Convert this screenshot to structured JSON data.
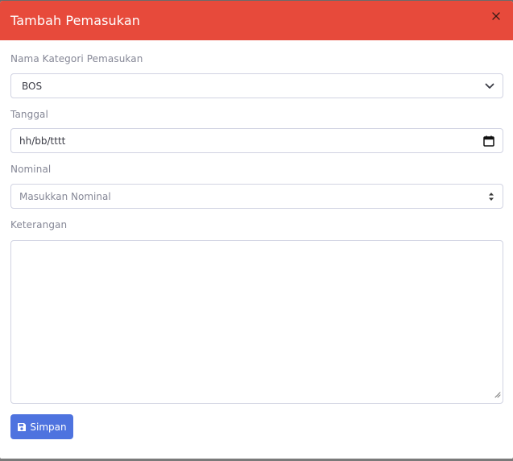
{
  "modal": {
    "title": "Tambah Pemasukan",
    "close_icon": "close-icon"
  },
  "form": {
    "category": {
      "label": "Nama Kategori Pemasukan",
      "selected": "BOS"
    },
    "date": {
      "label": "Tanggal",
      "value": "hh/bb/tttt",
      "icon": "calendar-icon"
    },
    "nominal": {
      "label": "Nominal",
      "placeholder": "Masukkan Nominal",
      "icon": "spinner-icon"
    },
    "notes": {
      "label": "Keterangan",
      "value": ""
    },
    "submit": {
      "label": "Simpan",
      "icon": "save-icon"
    }
  },
  "colors": {
    "header": "#e74a3b",
    "primary": "#4e73df",
    "label": "#858796",
    "border": "#d1d3e2"
  }
}
